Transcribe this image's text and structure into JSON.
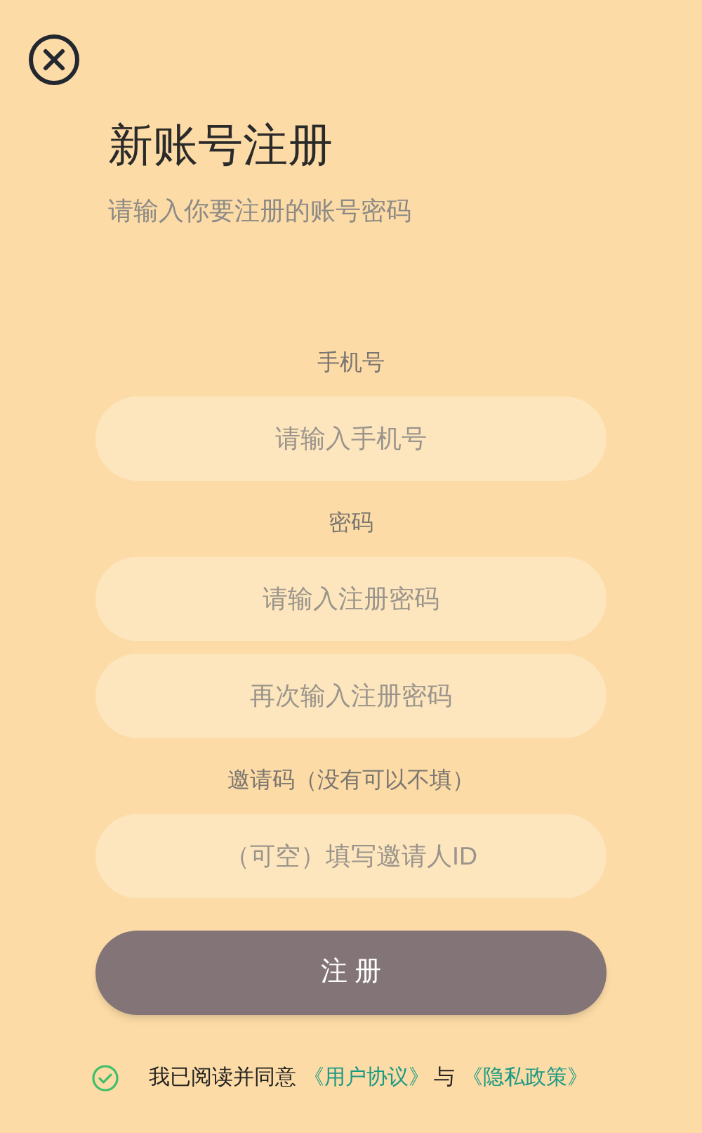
{
  "title": "新账号注册",
  "subtitle": "请输入你要注册的账号密码",
  "sections": [
    {
      "label": "手机号",
      "fields": [
        {
          "placeholder": "请输入手机号"
        }
      ]
    },
    {
      "label": "密码",
      "fields": [
        {
          "placeholder": "请输入注册密码"
        },
        {
          "placeholder": "再次输入注册密码"
        }
      ]
    },
    {
      "label": "邀请码（没有可以不填）",
      "fields": [
        {
          "placeholder": "（可空）填写邀请人ID"
        }
      ]
    }
  ],
  "submit_button": "注 册",
  "agreement": {
    "checked": true,
    "text": "我已阅读并同意",
    "link_1": "《用户协议》",
    "joiner": "与",
    "link_2": "《隐私政策》"
  }
}
